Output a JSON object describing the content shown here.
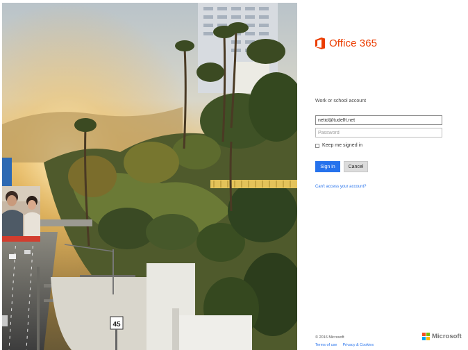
{
  "product": {
    "logo_icon": "office-logo-icon",
    "name": "Office 365",
    "brand_color": "#eb3c00"
  },
  "login": {
    "account_label": "Work or school account",
    "username_value": "netid@tudelft.net",
    "password_placeholder": "Password",
    "keep_signed_in_label": "Keep me signed in",
    "sign_in_label": "Sign in",
    "cancel_label": "Cancel",
    "cant_access_link": "Can't access your account?",
    "accent_color": "#2672ec"
  },
  "footer": {
    "copyright": "© 2016 Microsoft",
    "links": [
      "Terms of use",
      "Privacy & Cookies"
    ],
    "company_logo_text": "Microsoft",
    "company_logo_icon": "microsoft-logo-icon"
  },
  "background": {
    "image": "palm-tree-coastal-road-sunset-photo",
    "road_sign": "45"
  }
}
